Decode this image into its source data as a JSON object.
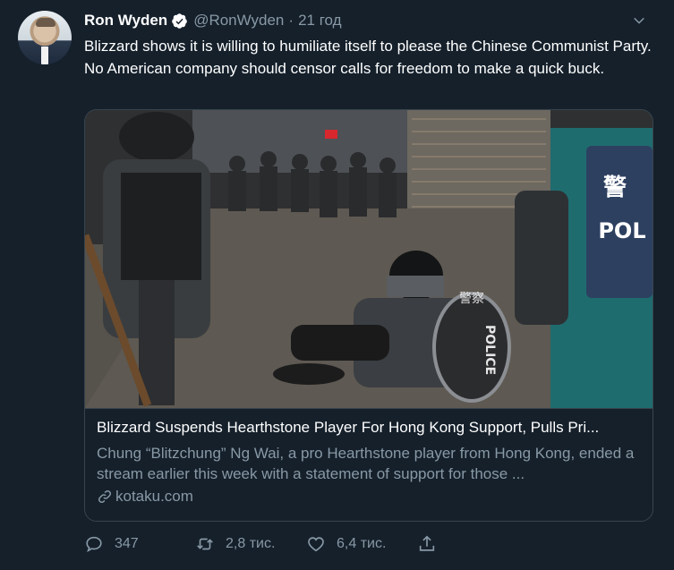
{
  "tweet": {
    "author_name": "Ron Wyden",
    "handle": "@RonWyden",
    "separator": "·",
    "time": "21 год",
    "text": "Blizzard shows it is willing to humiliate itself to please the Chinese Communist Party. No American company should censor calls for freedom to make a quick buck."
  },
  "card": {
    "title": "Blizzard Suspends Hearthstone Player For Hong Kong Support, Pulls Pri...",
    "description": "Chung “Blitzchung” Ng Wai, a pro Hearthstone player from Hong Kong, ended a stream earlier this week with a statement of support for those ...",
    "domain": "kotaku.com",
    "photo_signage": {
      "vest_char": "警",
      "vest_text": "POL",
      "shield_text": "POLICE",
      "shield_char": "警察"
    }
  },
  "actions": {
    "replies": "347",
    "retweets": "2,8 тис.",
    "likes": "6,4 тис."
  },
  "icons": {
    "verified": "verified-badge-icon",
    "caret": "chevron-down-icon",
    "link": "link-icon",
    "reply": "reply-icon",
    "retweet": "retweet-icon",
    "like": "heart-icon",
    "share": "share-icon"
  },
  "colors": {
    "background": "#15202b",
    "secondary_text": "#8899a6",
    "border": "#38444d",
    "verified": "#ffffff"
  }
}
